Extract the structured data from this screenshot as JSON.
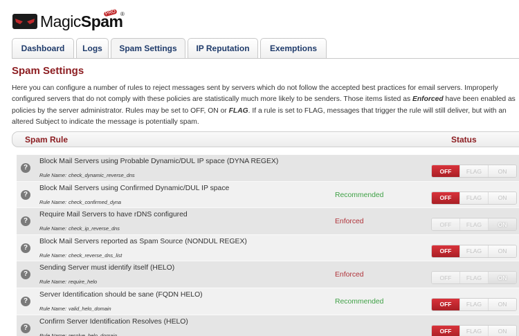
{
  "logo": {
    "text_a": "Magic",
    "text_b": "Spam",
    "badge": "PRO",
    "registered": "®"
  },
  "tabs": [
    {
      "label": "Dashboard",
      "active": false
    },
    {
      "label": "Logs",
      "active": false
    },
    {
      "label": "Spam Settings",
      "active": true
    },
    {
      "label": "IP Reputation",
      "active": false
    },
    {
      "label": "Exemptions",
      "active": false
    }
  ],
  "page": {
    "title": "Spam Settings",
    "intro": {
      "part1": "Here you can configure a number of rules to reject messages sent by servers which do not follow the accepted best practices for email servers. Improperly configured servers that do not comply with these policies are statistically much more likely to be senders. Those items listed as ",
      "enforced_word": "Enforced",
      "part2": " have been enabled as policies by the server administrator. Rules may be set to OFF, ON or ",
      "flag_word": "FLAG",
      "part3": ". If a rule is set to FLAG, messages that trigger the rule will still deliver, but with an altered Subject to indicate the message is potentially spam."
    }
  },
  "table": {
    "col_rule": "Spam Rule",
    "col_status": "Status",
    "rule_name_label": "Rule Name:",
    "toggle_labels": {
      "off": "OFF",
      "flag": "FLAG",
      "on": "ON"
    },
    "rows": [
      {
        "title": "Block Mail Servers using Probable Dynamic/DUL IP space (DYNA REGEX)",
        "rule_name": "check_dynamic_reverse_dns",
        "policy": "",
        "state": "off"
      },
      {
        "title": "Block Mail Servers using Confirmed Dynamic/DUL IP space",
        "rule_name": "check_confirmed_dyna",
        "policy": "Recommended",
        "state": "off"
      },
      {
        "title": "Require Mail Servers to have rDNS configured",
        "rule_name": "check_ip_reverse_dns",
        "policy": "Enforced",
        "state": "on"
      },
      {
        "title": "Block Mail Servers reported as Spam Source (NONDUL REGEX)",
        "rule_name": "check_reverse_dns_list",
        "policy": "",
        "state": "off"
      },
      {
        "title": "Sending Server must identify itself (HELO)",
        "rule_name": "require_helo",
        "policy": "Enforced",
        "state": "on"
      },
      {
        "title": "Server Identification should be sane (FQDN HELO)",
        "rule_name": "valid_helo_domain",
        "policy": "Recommended",
        "state": "off"
      },
      {
        "title": "Confirm Server Identification Resolves (HELO)",
        "rule_name": "resolve_helo_domain",
        "policy": "",
        "state": "off"
      }
    ]
  },
  "colors": {
    "brand": "#8c1d21",
    "off_active": "#c72a31",
    "recommended": "#3fa146",
    "enforced": "#b0333a"
  }
}
